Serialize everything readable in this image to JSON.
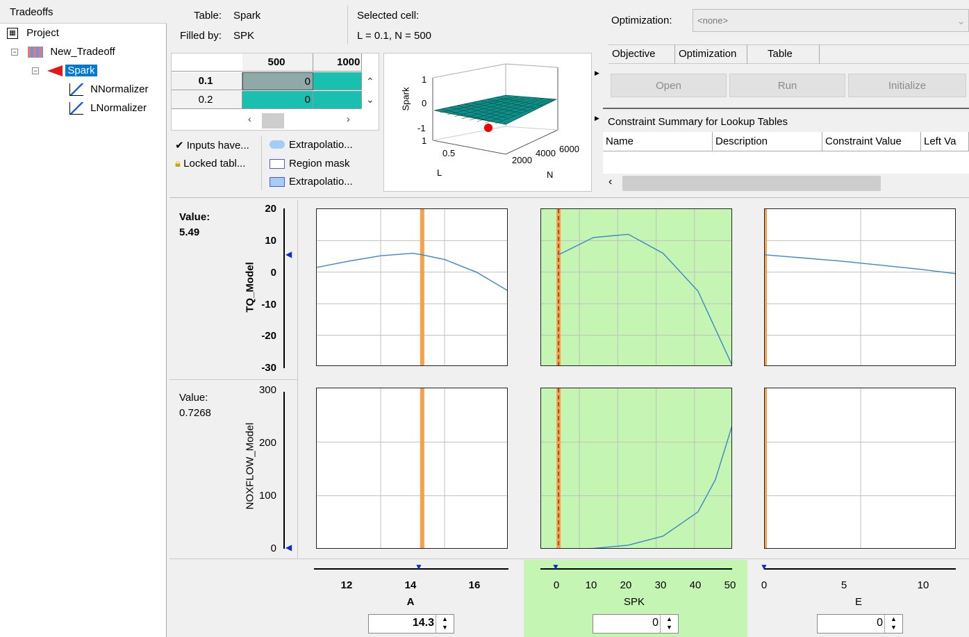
{
  "tree": {
    "header": "Tradeoffs",
    "items": [
      {
        "label": "Project"
      },
      {
        "label": "New_Tradeoff"
      },
      {
        "label": "Spark"
      },
      {
        "label": "NNormalizer"
      },
      {
        "label": "LNormalizer"
      }
    ]
  },
  "info": {
    "table_label": "Table:",
    "table_value": "Spark",
    "filled_label": "Filled by:",
    "filled_value": "SPK",
    "selected_label": "Selected cell:",
    "selected_value": "L = 0.1, N = 500"
  },
  "lookup_table": {
    "col_headers": [
      "500",
      "1000"
    ],
    "rows": [
      {
        "label": "0.1",
        "values": [
          "0",
          ""
        ]
      },
      {
        "label": "0.2",
        "values": [
          "0",
          ""
        ]
      }
    ]
  },
  "legend": {
    "items": [
      "Inputs have...",
      "Locked tabl...",
      "Extrapolatio...",
      "Region mask",
      "Extrapolatio..."
    ]
  },
  "surface_plot": {
    "zlabel": "Spark",
    "ylabel": "L",
    "xlabel": "N",
    "z_ticks": [
      "1",
      "0",
      "-1"
    ],
    "l_ticks": [
      "1",
      "0.5"
    ],
    "n_ticks": [
      "2000",
      "4000",
      "6000"
    ]
  },
  "optimization": {
    "label": "Optimization:",
    "value": "<none>",
    "tabs": [
      "Objective",
      "Optimization",
      "Table"
    ],
    "buttons": [
      "Open",
      "Run",
      "Initialize"
    ],
    "constraint_title": "Constraint Summary for Lookup Tables",
    "columns": [
      "Name",
      "Description",
      "Constraint Value",
      "Left Va"
    ]
  },
  "responses": [
    {
      "value_label": "Value:",
      "value": "5.49",
      "ylabel": "TQ_Model",
      "yticks": [
        "20",
        "10",
        "0",
        "-10",
        "-20",
        "-30"
      ]
    },
    {
      "value_label": "Value:",
      "value": "0.7268",
      "ylabel": "NOXFLOW_Model",
      "yticks": [
        "300",
        "200",
        "100",
        "0"
      ]
    }
  ],
  "factors": [
    {
      "name": "A",
      "ticks": [
        "12",
        "14",
        "16"
      ],
      "input_value": "14.3"
    },
    {
      "name": "SPK",
      "ticks": [
        "0",
        "10",
        "20",
        "30",
        "40",
        "50"
      ],
      "input_value": "0"
    },
    {
      "name": "E",
      "ticks": [
        "0",
        "5",
        "10"
      ],
      "input_value": "0"
    }
  ],
  "colors": {
    "accent": "#0078d7",
    "curve": "#3a86c8",
    "marker": "#f5a04a",
    "green_bg": "#c5f5b2",
    "teal": "#1abfb0"
  },
  "chart_data": {
    "type": "line",
    "series": [
      {
        "name": "TQ_Model vs A",
        "x": [
          11,
          12,
          13,
          14,
          14.3,
          15,
          16,
          17
        ],
        "values": [
          1.5,
          3.5,
          5.2,
          6.0,
          5.5,
          4.0,
          0.0,
          -6.0
        ]
      },
      {
        "name": "TQ_Model vs SPK",
        "x": [
          0,
          10,
          20,
          30,
          40,
          50
        ],
        "values": [
          5.5,
          11.0,
          12.0,
          6.0,
          -6.0,
          -30.0
        ]
      },
      {
        "name": "TQ_Model vs E",
        "x": [
          0,
          5,
          10,
          12.5
        ],
        "values": [
          5.5,
          3.5,
          1.0,
          -0.5
        ]
      },
      {
        "name": "NOXFLOW_Model vs SPK",
        "x": [
          0,
          10,
          20,
          30,
          40,
          45,
          50
        ],
        "values": [
          0,
          2,
          8,
          25,
          70,
          130,
          235
        ]
      }
    ],
    "ylim_top": [
      -30,
      20
    ],
    "ylim_bottom": [
      0,
      300
    ]
  }
}
